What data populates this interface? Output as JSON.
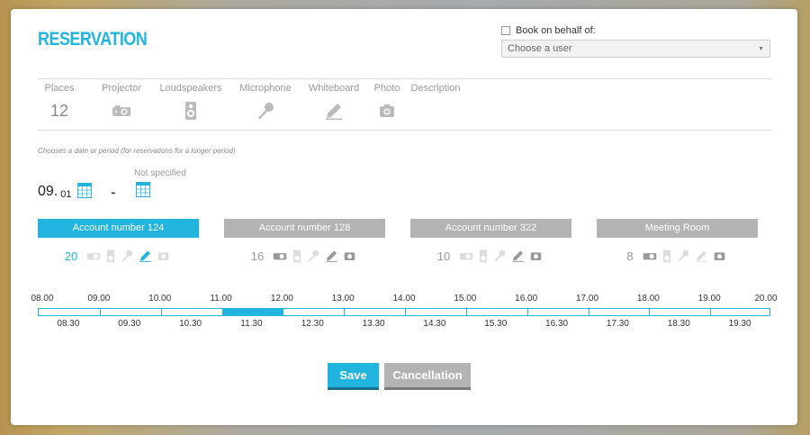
{
  "title": "RESERVATION",
  "behalf": {
    "label": "Book on behalf of:",
    "select_value": "Choose a user"
  },
  "features": [
    {
      "label": "Places",
      "value": "12",
      "icon": "places"
    },
    {
      "label": "Projector",
      "icon": "projector-icon"
    },
    {
      "label": "Loudspeakers",
      "icon": "speaker-icon"
    },
    {
      "label": "Microphone",
      "icon": "microphone-icon"
    },
    {
      "label": "Whiteboard",
      "icon": "pen-icon"
    },
    {
      "label": "Photo",
      "icon": "camera-icon"
    },
    {
      "label": "Description"
    }
  ],
  "hint": "Chooses a date or period (for reservations for a longer period)",
  "date": {
    "day": "09.",
    "month": "01",
    "separator": "-",
    "end_label": "Not specified"
  },
  "rooms": [
    {
      "name": "Account number 124",
      "count": "20",
      "active": true
    },
    {
      "name": "Account number 128",
      "count": "16",
      "active": false
    },
    {
      "name": "Account number 322",
      "count": "10",
      "active": false
    },
    {
      "name": "Meeting Room",
      "count": "8",
      "active": false
    }
  ],
  "timeline": {
    "hours": [
      "08.00",
      "09.00",
      "10.00",
      "11.00",
      "12.00",
      "13.00",
      "14.00",
      "15.00",
      "16.00",
      "17.00",
      "18.00",
      "19.00",
      "20.00"
    ],
    "half_hours": [
      "08.30",
      "09.30",
      "10.30",
      "11.30",
      "12.30",
      "13.30",
      "14.30",
      "15.30",
      "16.30",
      "17.30",
      "18.30",
      "19.30"
    ],
    "selected_start_hour": 11.0,
    "selected_end_hour": 12.0
  },
  "actions": {
    "save": "Save",
    "cancel": "Cancellation"
  },
  "colors": {
    "accent": "#21b4de",
    "inactive": "#b3b3b3"
  }
}
